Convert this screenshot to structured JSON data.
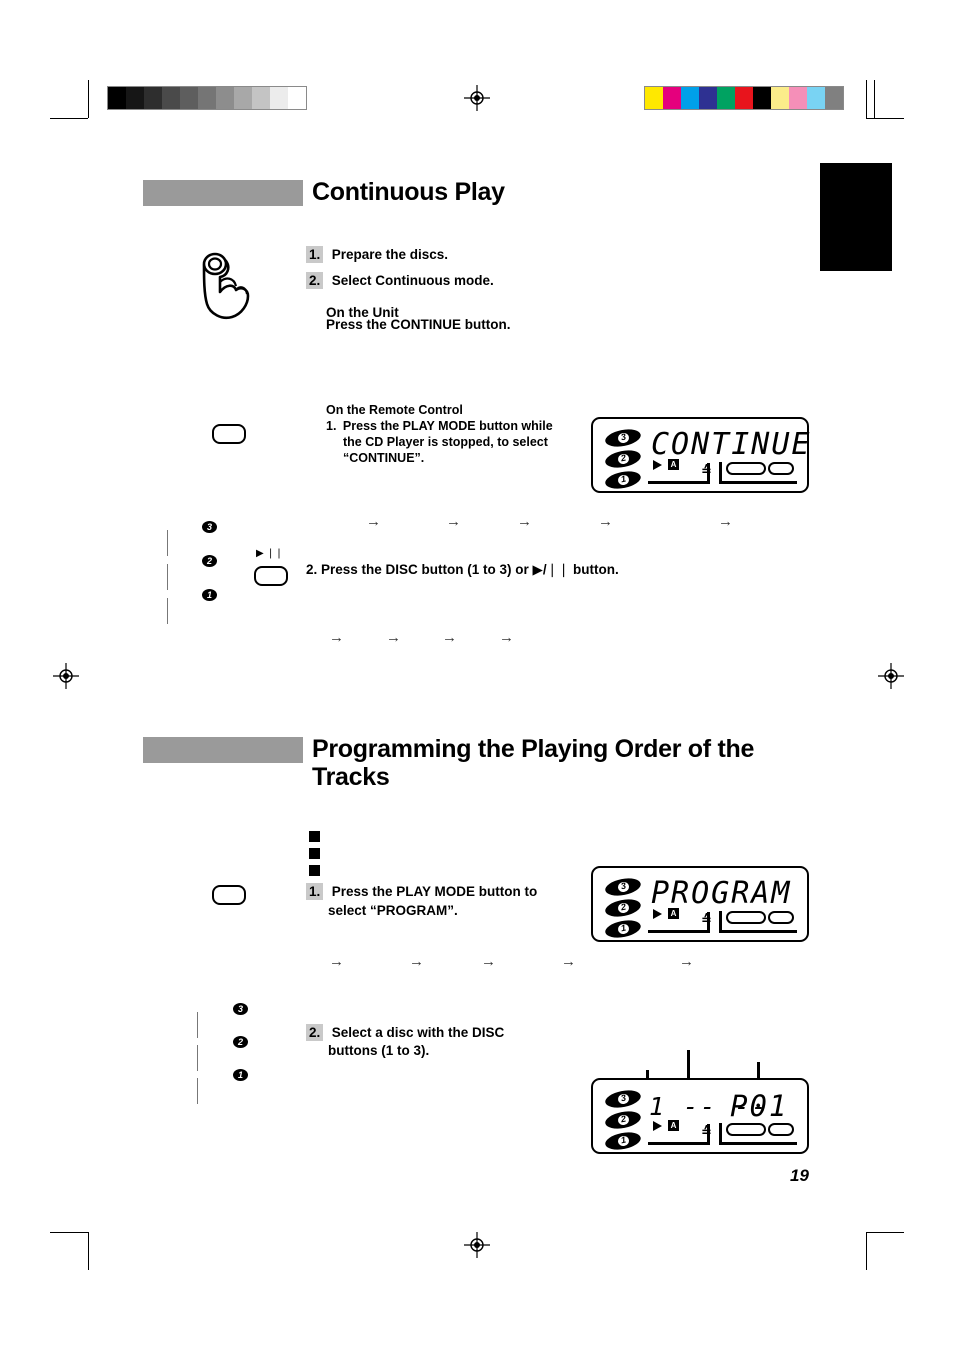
{
  "document": {
    "page_number": "19",
    "type": "audio-equipment-user-manual-page"
  },
  "calibration": {
    "grayscale_steps": [
      "#000000",
      "#161616",
      "#2e2e2e",
      "#4a4a4a",
      "#5e5e5e",
      "#757575",
      "#8d8d8d",
      "#a8a8a8",
      "#c4c4c4",
      "#ececec",
      "#ffffff"
    ],
    "color_patches": [
      "#ffe800",
      "#e5007d",
      "#00a0e9",
      "#2e3192",
      "#00a261",
      "#e8141c",
      "#000000",
      "#fbec8a",
      "#f58fb8",
      "#79d3f3",
      "#808080"
    ]
  },
  "sections": [
    {
      "id": "continuous-play",
      "title": "Continuous Play",
      "steps": [
        {
          "num": "1.",
          "text": "Prepare the discs."
        },
        {
          "num": "2.",
          "text": "Select Continuous mode."
        }
      ],
      "unit_label": "On the Unit",
      "unit_instruction": "Press the CONTINUE button.",
      "remote_label": "On the Remote Control",
      "remote_step1_num": "1.",
      "remote_step1_line1": "Press the PLAY MODE button while",
      "remote_step1_line2": "the CD Player is stopped, to select",
      "remote_step1_line3": "“CONTINUE”.",
      "remote_step2": "2.  Press the DISC button (1 to 3) or ▶/❘❘ button."
    },
    {
      "id": "programming-order",
      "title_line1": "Programming the Playing Order of the",
      "title_line2": "Tracks",
      "step1_num": "1.",
      "step1_line1": "Press the PLAY MODE button to",
      "step1_line2": "select “PROGRAM”.",
      "step2_num": "2.",
      "step2_line1": "Select a disc with the DISC",
      "step2_line2": "buttons  (1 to 3)."
    }
  ],
  "displays": [
    {
      "id": "display-continue",
      "main_text": "CONTINUE",
      "disc_indicators": [
        "3",
        "2",
        "1"
      ],
      "play_symbol": "▶",
      "mode_symbol": "A"
    },
    {
      "id": "display-program",
      "main_text": "PROGRAM",
      "disc_indicators": [
        "3",
        "2",
        "1"
      ],
      "play_symbol": "▶",
      "mode_symbol": "A"
    },
    {
      "id": "display-p01",
      "track_area": "1 -- --",
      "program_text": "P01",
      "disc_indicators": [
        "3",
        "2",
        "1"
      ],
      "play_symbol": "▶",
      "mode_symbol": "A"
    }
  ],
  "controls": {
    "remote_play_mode_button": "PLAY MODE button",
    "play_pause_symbol": "▶ ❘❘",
    "disc_buttons": [
      "3",
      "2",
      "1"
    ]
  },
  "flow_arrows": {
    "glyph": "→",
    "row1_count": 5,
    "row2_count": 4,
    "row3_count": 5
  },
  "bullets": {
    "count": 3
  }
}
